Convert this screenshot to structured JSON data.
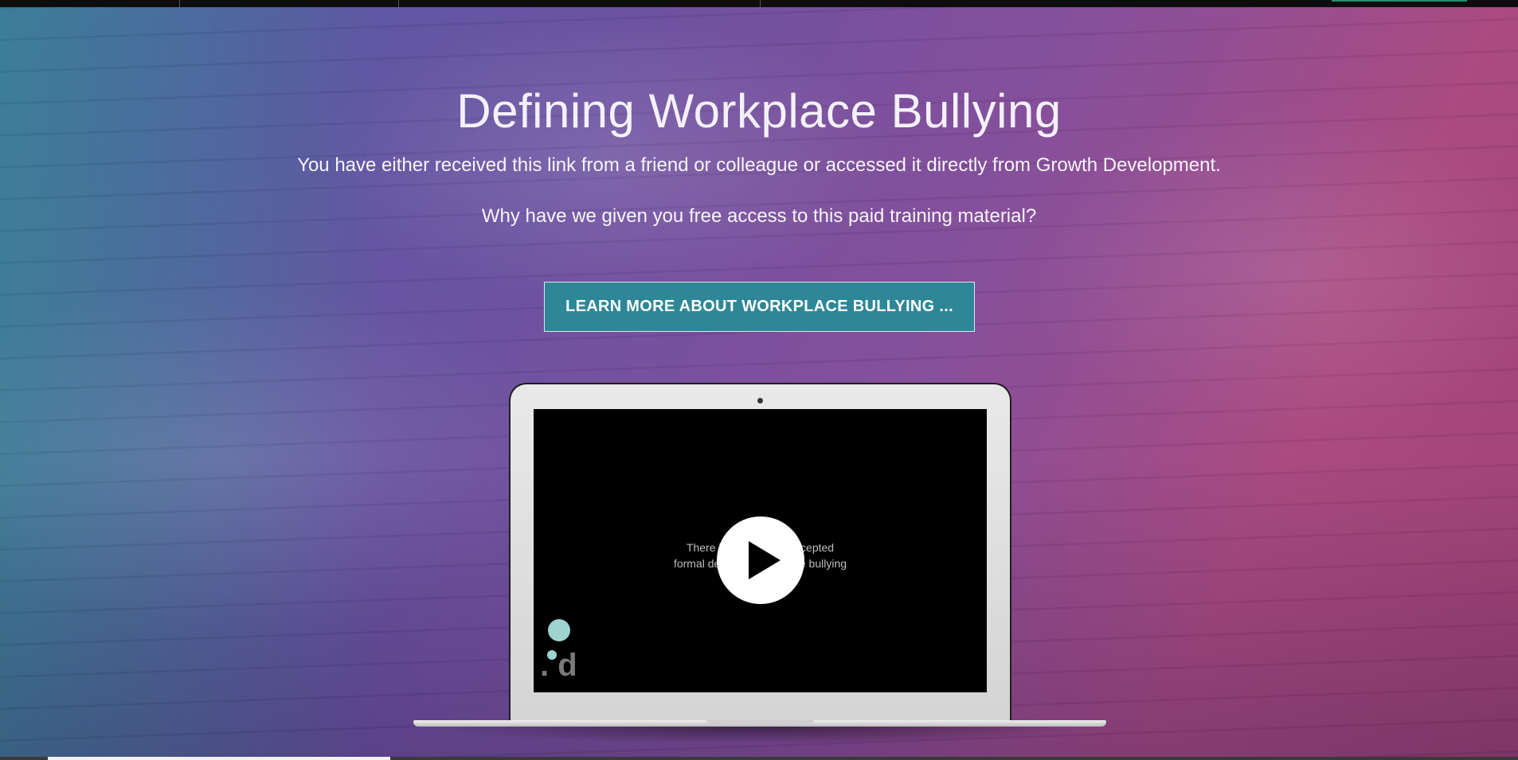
{
  "page": {
    "title": "Defining Workplace Bullying",
    "intro": "You have either received this link from a friend or colleague or accessed it directly from Growth Development.",
    "question": "Why have we given you free access to this paid training material?",
    "cta_label": "LEARN MORE ABOUT WORKPLACE BULLYING ..."
  },
  "video": {
    "caption_line1": "There is no accepted",
    "caption_line2": "formal definition of workplace bullying",
    "visible_line1": "There is                      ccepted",
    "visible_line2": "formal defi                      ce bullying",
    "logo_text": ". d",
    "play_icon": "play-icon"
  },
  "colors": {
    "cta_background": "#2e8797",
    "logo_dots": "#9ed3cf"
  }
}
